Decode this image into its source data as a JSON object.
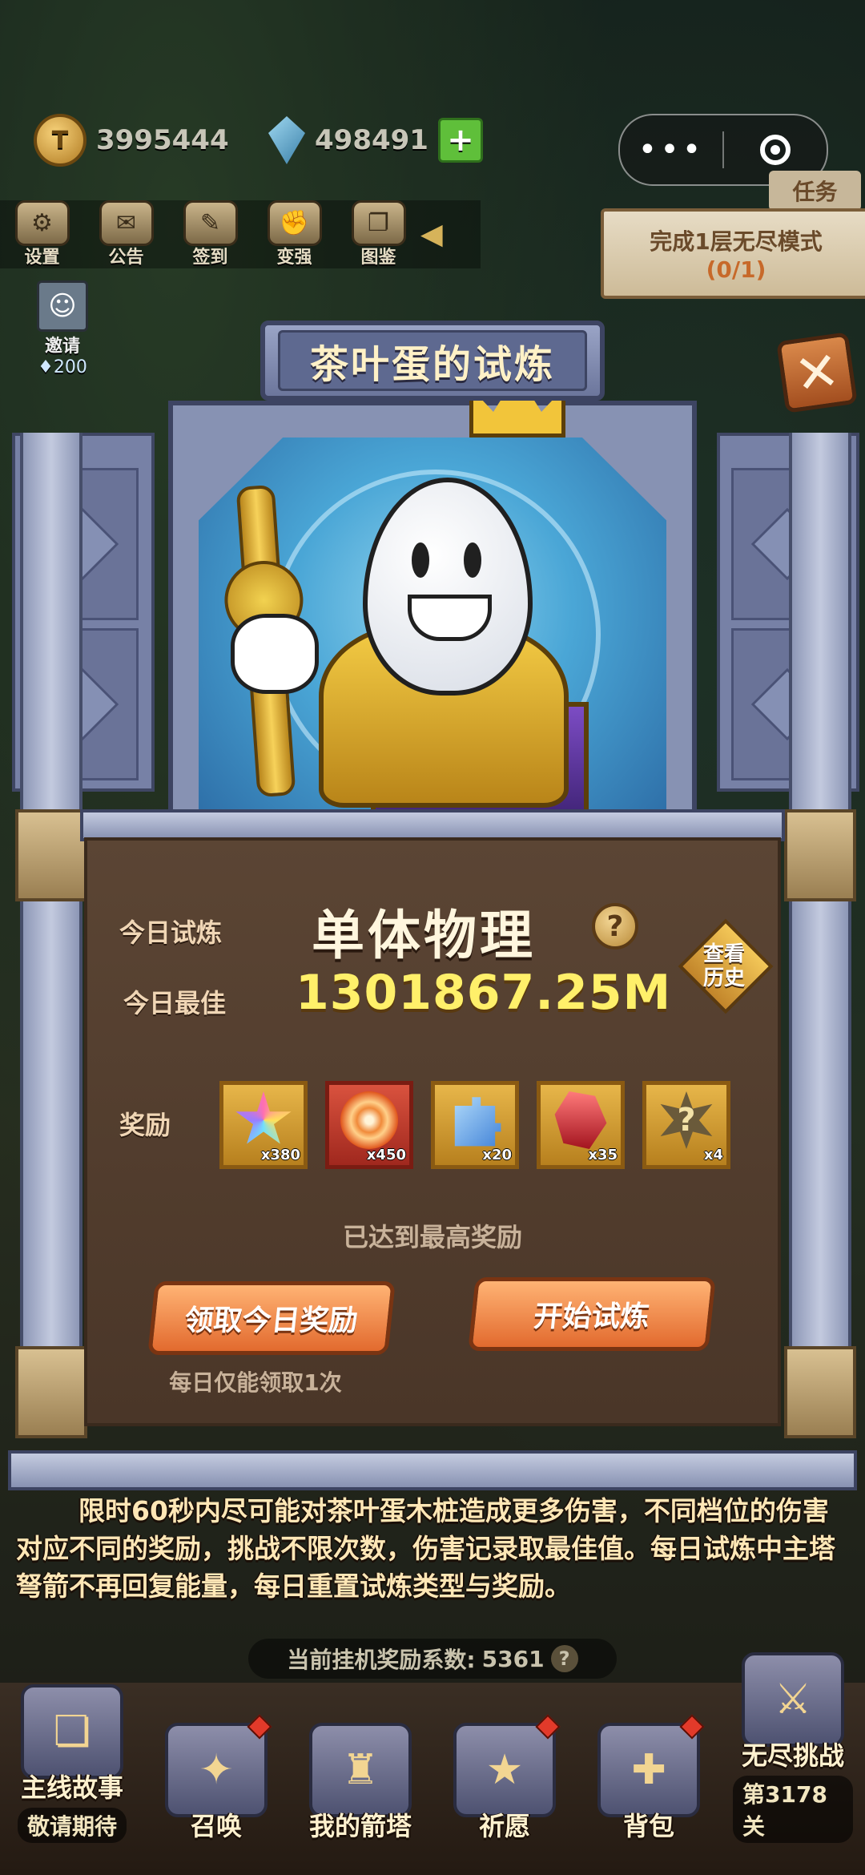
{
  "hud": {
    "coins": "3995444",
    "gems": "498491",
    "plus_label": "+",
    "capsule_more": "•••"
  },
  "top_menu": [
    {
      "label": "设置",
      "icon": "gear-icon",
      "glyph": "⚙"
    },
    {
      "label": "公告",
      "icon": "scroll-icon",
      "glyph": "✉"
    },
    {
      "label": "签到",
      "icon": "quill-icon",
      "glyph": "✎"
    },
    {
      "label": "变强",
      "icon": "fist-icon",
      "glyph": "✊"
    },
    {
      "label": "图鉴",
      "icon": "book-icon",
      "glyph": "❐"
    }
  ],
  "invite": {
    "label": "邀请",
    "cost": "200"
  },
  "task": {
    "tag": "任务",
    "title": "完成1层无尽模式",
    "progress": "(0/1)"
  },
  "modal": {
    "title": "茶叶蛋的试炼",
    "close_label": "✕",
    "today_trial_label": "今日试炼",
    "today_trial_type": "单体物理",
    "help_label": "?",
    "today_best_label": "今日最佳",
    "today_best_value": "1301867.25M",
    "history_label_1": "查看",
    "history_label_2": "历史",
    "rewards_label": "奖励",
    "rewards": [
      {
        "name": "rainbow-star-icon",
        "count": "x380"
      },
      {
        "name": "swirl-candy-icon",
        "count": "x450"
      },
      {
        "name": "puzzle-piece-icon",
        "count": "x20"
      },
      {
        "name": "red-rune-icon",
        "count": "x35"
      },
      {
        "name": "mystery-box-icon",
        "count": "x4"
      }
    ],
    "max_reward_tip": "已达到最高奖励",
    "claim_button": "领取今日奖励",
    "start_button": "开始试炼",
    "claim_note": "每日仅能领取1次"
  },
  "description": "限时60秒内尽可能对茶叶蛋木桩造成更多伤害，不同档位的伤害对应不同的奖励，挑战不限次数，伤害记录取最佳值。每日试炼中主塔弩箭不再回复能量，每日重置试炼类型与奖励。",
  "idle_bar": {
    "label": "当前挂机奖励系数:",
    "value": "5361",
    "help": "?"
  },
  "bottom_nav": [
    {
      "label": "主线故事",
      "sub": "敬请期待",
      "glyph": "❏"
    },
    {
      "label": "召唤",
      "sub": "",
      "glyph": "✦"
    },
    {
      "label": "我的箭塔",
      "sub": "",
      "glyph": "♜"
    },
    {
      "label": "祈愿",
      "sub": "",
      "glyph": "★"
    },
    {
      "label": "背包",
      "sub": "",
      "glyph": "✚"
    },
    {
      "label": "无尽挑战",
      "sub": "第3178关",
      "glyph": "⚔"
    }
  ],
  "colors": {
    "accent_orange": "#e26a2e",
    "best_value_yellow": "#fff06a",
    "panel_brown": "#5b4534"
  }
}
